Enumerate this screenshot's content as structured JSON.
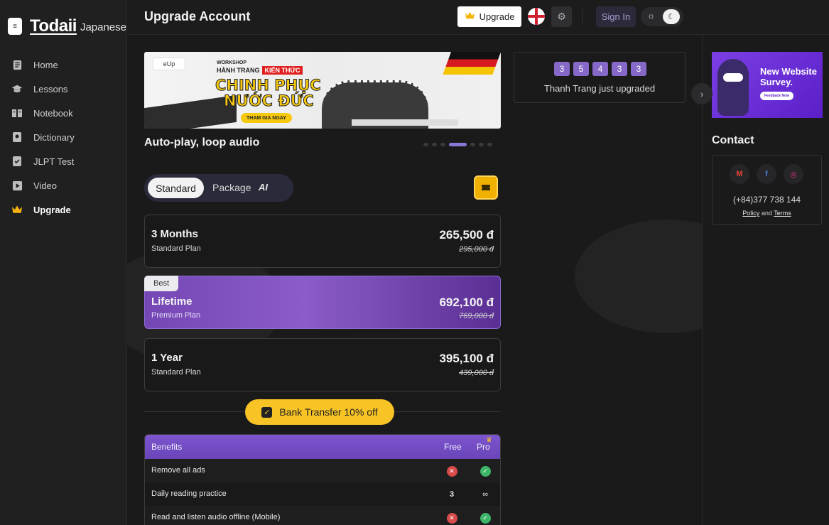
{
  "app": {
    "menu_icon": "menu-icon",
    "brand": "Todaii",
    "brand_sub": "Japanese"
  },
  "sidebar": {
    "items": [
      {
        "label": "Home",
        "icon": "home-icon"
      },
      {
        "label": "Lessons",
        "icon": "graduation-cap-icon"
      },
      {
        "label": "Notebook",
        "icon": "notebook-icon"
      },
      {
        "label": "Dictionary",
        "icon": "dictionary-icon"
      },
      {
        "label": "JLPT Test",
        "icon": "test-icon"
      },
      {
        "label": "Video",
        "icon": "video-icon"
      },
      {
        "label": "Upgrade",
        "icon": "crown-icon",
        "active": true
      }
    ]
  },
  "header": {
    "title": "Upgrade Account",
    "upgrade_label": "Upgrade",
    "signin_label": "Sign In",
    "language_flag": "england-flag-icon"
  },
  "banner": {
    "small_logo": "eUp",
    "workshop": "WORKSHOP",
    "line1": "HÀNH TRANG",
    "line1_highlight": "KIẾN THỨC",
    "headline1": "CHINH PHỤC",
    "headline2": "NƯỚC ĐỨC",
    "cta": "THAM GIA NGAY"
  },
  "slider": {
    "caption": "Auto-play, loop audio",
    "dot_count": 8,
    "active_dot": 3
  },
  "plan_toggle": {
    "standard": "Standard",
    "package": "Package",
    "ai": "AI"
  },
  "plans": [
    {
      "name": "3 Months",
      "type": "Standard Plan",
      "price": "265,500 đ",
      "old_price": "295,000 đ"
    },
    {
      "name": "Lifetime",
      "type": "Premium Plan",
      "price": "692,100 đ",
      "old_price": "769,000 đ",
      "badge": "Best"
    },
    {
      "name": "1 Year",
      "type": "Standard Plan",
      "price": "395,100 đ",
      "old_price": "439,000 đ"
    }
  ],
  "bank_transfer": {
    "label": "Bank Transfer 10% off",
    "checked": true
  },
  "benefits": {
    "header": {
      "label": "Benefits",
      "free": "Free",
      "pro": "Pro"
    },
    "rows": [
      {
        "label": "Remove all ads",
        "free": "x",
        "pro": "check"
      },
      {
        "label": "Daily reading practice",
        "free": "3",
        "pro": "∞"
      },
      {
        "label": "Read and listen audio offline (Mobile)",
        "free": "x",
        "pro": "check"
      }
    ]
  },
  "ticker": {
    "numbers": [
      "3",
      "5",
      "4",
      "3",
      "3"
    ],
    "message": "Thanh Trang just upgraded"
  },
  "survey": {
    "title_line1": "New Website",
    "title_line2": "Survey.",
    "cta": "Feedback Now"
  },
  "contact": {
    "title": "Contact",
    "socials": [
      "gmail-icon",
      "facebook-icon",
      "instagram-icon"
    ],
    "phone": "(+84)377 738 144",
    "policy": "Policy",
    "and": "and",
    "terms": "Terms"
  },
  "colors": {
    "accent_purple": "#8568c7",
    "accent_yellow": "#f7c325",
    "background": "#1a1a1b"
  }
}
